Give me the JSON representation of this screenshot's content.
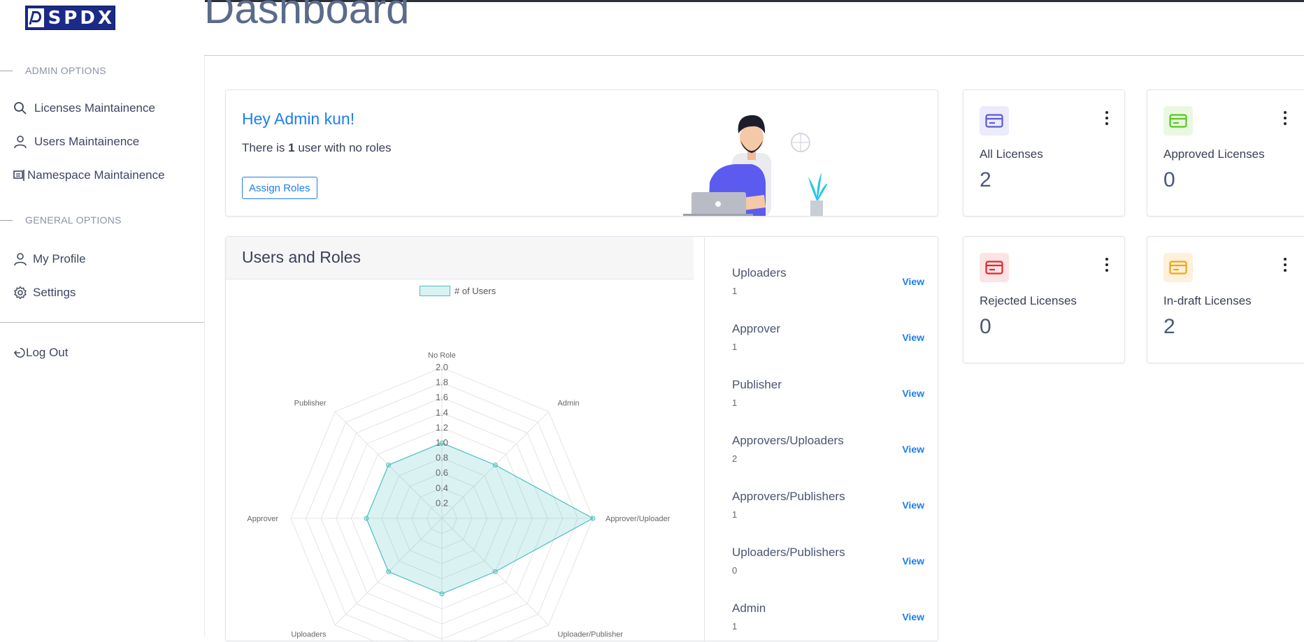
{
  "logo": {
    "text": "SPDX"
  },
  "sidebar": {
    "admin_label": "ADMIN OPTIONS",
    "general_label": "GENERAL OPTIONS",
    "admin_items": [
      {
        "label": "Licenses Maintainence",
        "icon": "search-icon"
      },
      {
        "label": "Users Maintainence",
        "icon": "user-icon"
      },
      {
        "label": "Namespace Maintainence",
        "icon": "namespace-icon"
      }
    ],
    "general_items": [
      {
        "label": "My Profile",
        "icon": "user-icon"
      },
      {
        "label": "Settings",
        "icon": "gear-icon"
      }
    ],
    "logout": "Log Out"
  },
  "header": {
    "title": "Dashboard"
  },
  "welcome": {
    "title": "Hey Admin kun!",
    "text_before": "There is ",
    "count": "1",
    "text_after": " user with no roles",
    "button": "Assign Roles"
  },
  "stats": [
    {
      "label": "All Licenses",
      "value": "2",
      "color": "#5b5bd6",
      "bg": "#ebebfb"
    },
    {
      "label": "Approved Licenses",
      "value": "0",
      "color": "#56c91e",
      "bg": "#eaf8e2"
    },
    {
      "label": "Rejected Licenses",
      "value": "0",
      "color": "#e0262f",
      "bg": "#fce4e4"
    },
    {
      "label": "In-draft Licenses",
      "value": "2",
      "color": "#f5a40f",
      "bg": "#fdf1dc"
    }
  ],
  "roles_card": {
    "title": "Users and Roles",
    "view_label": "View",
    "roles": [
      {
        "name": "Uploaders",
        "count": "1"
      },
      {
        "name": "Approver",
        "count": "1"
      },
      {
        "name": "Publisher",
        "count": "1"
      },
      {
        "name": "Approvers/Uploaders",
        "count": "2"
      },
      {
        "name": "Approvers/Publishers",
        "count": "1"
      },
      {
        "name": "Uploaders/Publishers",
        "count": "0"
      },
      {
        "name": "Admin",
        "count": "1"
      }
    ]
  },
  "chart_data": {
    "type": "radar",
    "legend": "# of Users",
    "labels": [
      "No Role",
      "Admin",
      "Approver/Uploader",
      "Uploader/Publisher",
      "",
      "Uploaders",
      "Approver",
      "Publisher"
    ],
    "values": [
      1,
      1,
      2,
      1,
      1,
      1,
      1,
      1
    ],
    "scale_ticks": [
      "0.2",
      "0.4",
      "0.6",
      "0.8",
      "1.0",
      "1.2",
      "1.4",
      "1.6",
      "1.8",
      "2.0"
    ],
    "rmax": 2.0,
    "color": "#4bc0c0"
  }
}
